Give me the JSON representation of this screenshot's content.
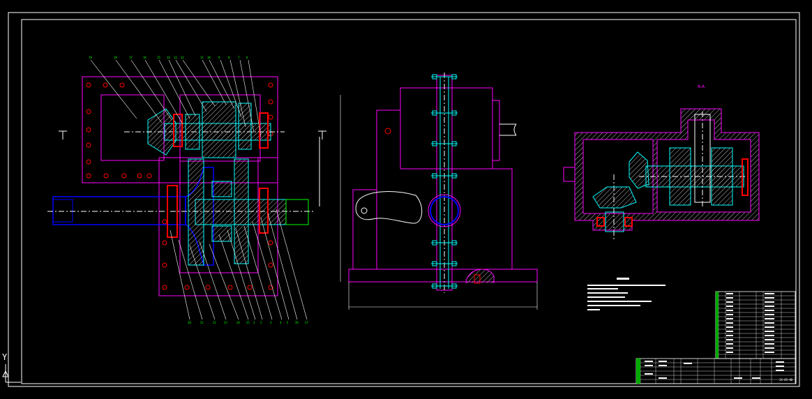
{
  "drawing": {
    "background": "#000000",
    "colors": {
      "border": "#ffffff",
      "outline": "#ff00ff",
      "shaft": "#0000ff",
      "gear": "#00ffff",
      "hatch": "#c8c8c8",
      "seal": "#ff0000",
      "center": "#ffffff",
      "balloon": "#00ff00",
      "cam": "#ffffff"
    },
    "section_label": "A-A",
    "ucs_label": "Y",
    "part_numbers_top": [
      "19",
      "18",
      "17",
      "16",
      "15",
      "14",
      "13",
      "12",
      "11",
      "10",
      "9",
      "8",
      "7",
      "6"
    ],
    "part_numbers_bottom": [
      "20",
      "21",
      "22",
      "23",
      "24",
      "25",
      "1",
      "2",
      "3",
      "4",
      "5",
      "26",
      "27"
    ],
    "icons": [
      "ucs-axis-icon"
    ]
  },
  "title_block": {
    "drawing_no": "JX-05-00"
  }
}
